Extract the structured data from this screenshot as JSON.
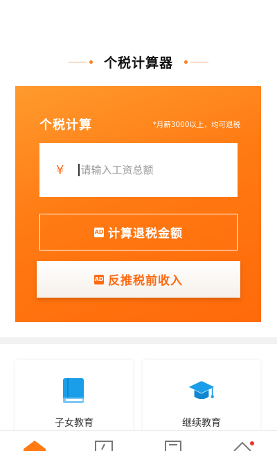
{
  "header": {
    "title": "个税计算器"
  },
  "calculator": {
    "title": "个税计算",
    "note": "*月薪3000以上，均可退税",
    "currency_symbol": "¥",
    "salary_placeholder": "请输入工资总额",
    "salary_value": "",
    "calc_button_label": "计算退税金额",
    "reverse_button_label": "反推税前收入",
    "ad_badge": "AD"
  },
  "features": [
    {
      "label": "子女教育",
      "icon": "book-icon"
    },
    {
      "label": "继续教育",
      "icon": "graduation-cap-icon"
    }
  ],
  "bottom_nav": {
    "items": [
      {
        "icon": "home-icon",
        "active": true
      },
      {
        "icon": "calculator-icon",
        "active": false
      },
      {
        "icon": "document-icon",
        "active": false
      },
      {
        "icon": "house-outline-icon",
        "active": false,
        "has_badge": true
      }
    ]
  },
  "colors": {
    "accent": "#ff7a12",
    "feature_icon": "#1a9eea",
    "badge_dot": "#e8342a"
  }
}
